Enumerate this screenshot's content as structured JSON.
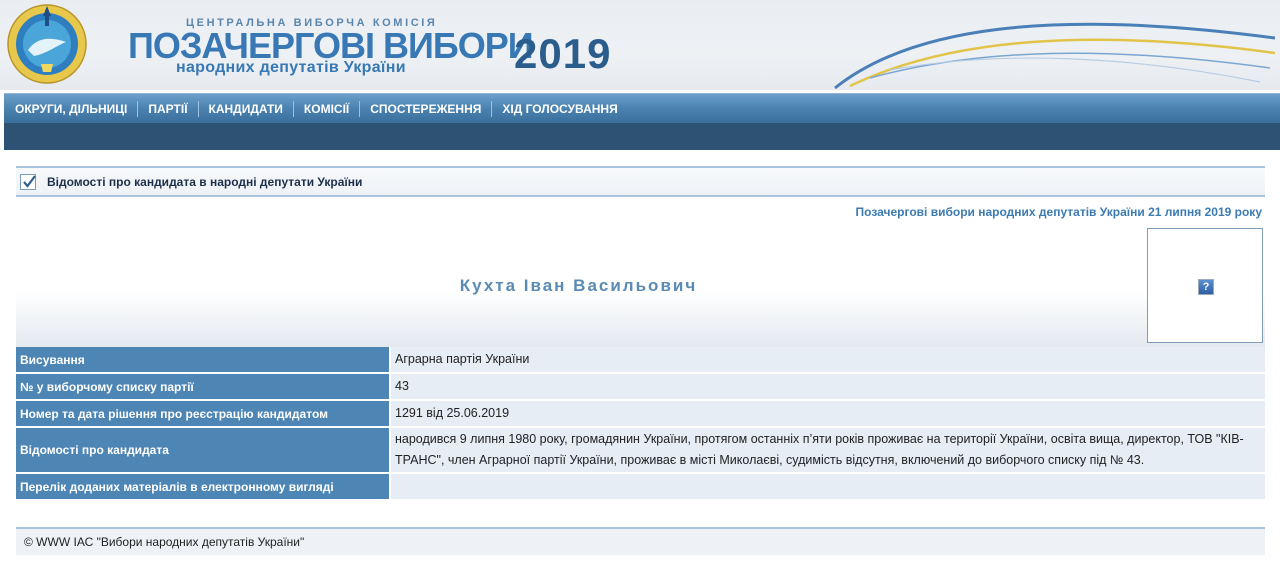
{
  "header": {
    "org": "ЦЕНТРАЛЬНА ВИБОРЧА КОМІСІЯ",
    "title": "ПОЗАЧЕРГОВІ ВИБОРИ",
    "subtitle": "народних депутатів України",
    "year": "2019"
  },
  "nav": {
    "items": [
      "ОКРУГИ, ДІЛЬНИЦІ",
      "ПАРТІЇ",
      "КАНДИДАТИ",
      "КОМІСІЇ",
      "СПОСТЕРЕЖЕННЯ",
      "ХІД ГОЛОСУВАННЯ"
    ]
  },
  "section": {
    "title": "Відомості про кандидата в народні депутати України",
    "icon": "checkbox-icon"
  },
  "election": "Позачергові вибори народних депутатів України 21 липня 2019 року",
  "candidate": {
    "name": "Кухта Іван Васильович",
    "photo_placeholder": "?"
  },
  "details": [
    {
      "label": "Висування",
      "value": "Аграрна партія України"
    },
    {
      "label": "№ у виборчому списку партії",
      "value": "43"
    },
    {
      "label": "Номер та дата рішення про реєстрацію кандидатом",
      "value": "1291 від 25.06.2019"
    },
    {
      "label": "Відомості про кандидата",
      "value": "народився 9 липня 1980 року, громадянин України, протягом останніх п’яти років проживає на території України, освіта вища, директор, ТОВ \"КІВ-ТРАНС\", член Аграрної партії України, проживає в місті Миколаєві, судимість відсутня, включений до виборчого списку під № 43."
    },
    {
      "label": "Перелік доданих матеріалів в електронному вигляді",
      "value": ""
    }
  ],
  "footer": "© WWW ІАС \"Вибори народних депутатів України\"",
  "colors": {
    "nav": "#4a82b0",
    "label_bg": "#4d85b5",
    "value_bg": "#e6edf5",
    "accent": "#3878b4"
  }
}
